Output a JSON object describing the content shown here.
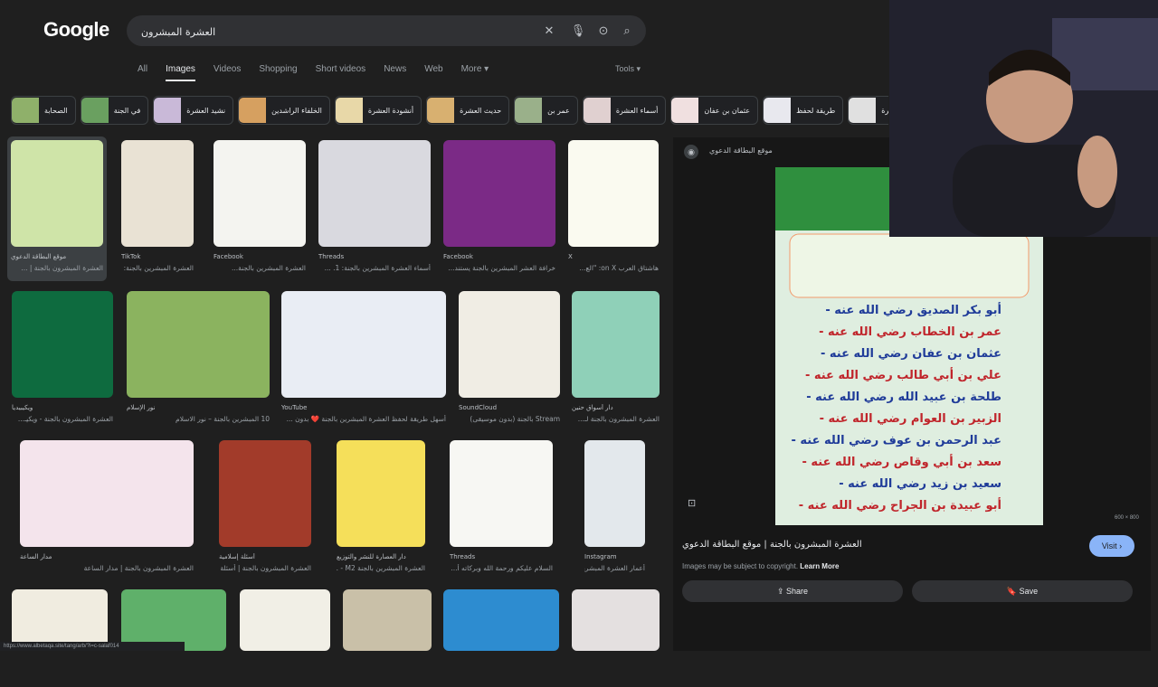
{
  "header": {
    "logo": "Google",
    "search_value": "العشرة المبشرون",
    "icons": {
      "clear": "close-icon",
      "voice": "microphone-icon",
      "lens": "camera-search-icon",
      "search": "search-icon"
    }
  },
  "tabs": [
    {
      "label": "All"
    },
    {
      "label": "Images",
      "active": true
    },
    {
      "label": "Videos"
    },
    {
      "label": "Shopping"
    },
    {
      "label": "Short videos"
    },
    {
      "label": "News"
    },
    {
      "label": "Web"
    },
    {
      "label": "More"
    }
  ],
  "tools_label": "Tools",
  "chips": [
    "الصحابة",
    "في الجنة",
    "نشيد العشرة",
    "الخلفاء الراشدين",
    "أنشودة العشرة",
    "حديث العشرة",
    "عمر بن",
    "أسماء العشرة",
    "عثمان بن عفان",
    "طريقة لحفظ",
    "العشرة"
  ],
  "results": [
    {
      "src": "موقع البطاقة الدعوي",
      "title": "العشرة المبشرون بالجنة | ...",
      "bg": "#cfe4a8"
    },
    {
      "src": "TikTok",
      "title": "العشرة المبشرين بالجنة: فـ...",
      "bg": "#e9e2d4"
    },
    {
      "src": "Facebook",
      "title": "العشرة المبشرين بالجنة...",
      "bg": "#f4f4f0"
    },
    {
      "src": "Threads",
      "title": "أسماء العشرة المبشرين بالجنة: 1. ...",
      "bg": "#d9d9df"
    },
    {
      "src": "Facebook",
      "title": "خرافة العشر المبشرين بالجنة يستند...",
      "bg": "#7b2a86"
    },
    {
      "src": "X",
      "title": "هاشتاق العرب on X: \"الع...",
      "bg": "#fafaf0"
    },
    {
      "src": "ويكيبيديا",
      "title": "العشرة المبشرون بالجنة - ويكيـ...",
      "bg": "#0e6b3f"
    },
    {
      "src": "نور الإسلام",
      "title": "10 المبشرين بالجنة – نور الاسلام",
      "bg": "#8bb35f"
    },
    {
      "src": "YouTube",
      "title": "أسهل طريقة لحفظ العشرة المبشرين بالجنة ❤️ بدون ...",
      "bg": "#e9edf4"
    },
    {
      "src": "SoundCloud",
      "title": "Stream بالجنة (بدون موسيقى)",
      "bg": "#f0ede4"
    },
    {
      "src": "دار أسواق حنين",
      "title": "العشرة المبشرون بالجنة لـ...",
      "bg": "#8fd0b8"
    },
    {
      "src": "مدار الساعة",
      "title": "العشرة المبشرون بالجنة | مدار الساعة",
      "bg": "#f4e4ec"
    },
    {
      "src": "أسئلة إسلامية",
      "title": "العشرة المبشرون بالجنة | أسئلة ...",
      "bg": "#a23b2a"
    },
    {
      "src": "دار العصارة للنشر والتوزيع",
      "title": "العشرة المبشرين بالجنة M2 - ...",
      "bg": "#f5df5a"
    },
    {
      "src": "Threads",
      "title": "السلام عليكم ورحمة الله وبركاته أ...",
      "bg": "#f7f7f3"
    },
    {
      "src": "Instagram",
      "title": "أعمار العشرة المبشرين بال...",
      "bg": "#e3e8ec"
    },
    {
      "src": "",
      "title": "",
      "bg": "#f0ece0"
    },
    {
      "src": "",
      "title": "",
      "bg": "#5fb06a"
    },
    {
      "src": "",
      "title": "",
      "bg": "#f1efe6"
    },
    {
      "src": "",
      "title": "",
      "bg": "#c9c0a8"
    },
    {
      "src": "",
      "title": "",
      "bg": "#2d8cd0"
    },
    {
      "src": "",
      "title": "",
      "bg": "#e4e0e0"
    }
  ],
  "panel": {
    "site": "موقع البطاقة الدعوي",
    "image_lines": [
      "أبو بكر الصديق رضي الله عنه",
      "عمر بن الخطاب رضي الله عنه",
      "عثمان بن عفان رضي الله عنه",
      "علي بن أبي طالب رضي الله عنه",
      "طلحة بن عبيد الله رضي الله عنه",
      "الزبير بن العوام رضي الله عنه",
      "عبد الرحمن بن عوف رضي الله عنه",
      "سعد بن أبي وقاص رضي الله عنه",
      "سعيد بن زيد رضي الله عنه",
      "أبو عبيدة بن الجراح رضي الله عنه"
    ],
    "image_header": "رون بالجنة",
    "dimensions": "600 × 800",
    "title": "العشرة المبشرون بالجنة | موقع البطاقة الدعوي",
    "visit_label": "Visit",
    "copyright": "Images may be subject to copyright.",
    "learn_more": "Learn More",
    "share_label": "Share",
    "save_label": "Save"
  },
  "status_url": "https://www.albetaqa.site/tang/arb/?i=c-salaf014"
}
